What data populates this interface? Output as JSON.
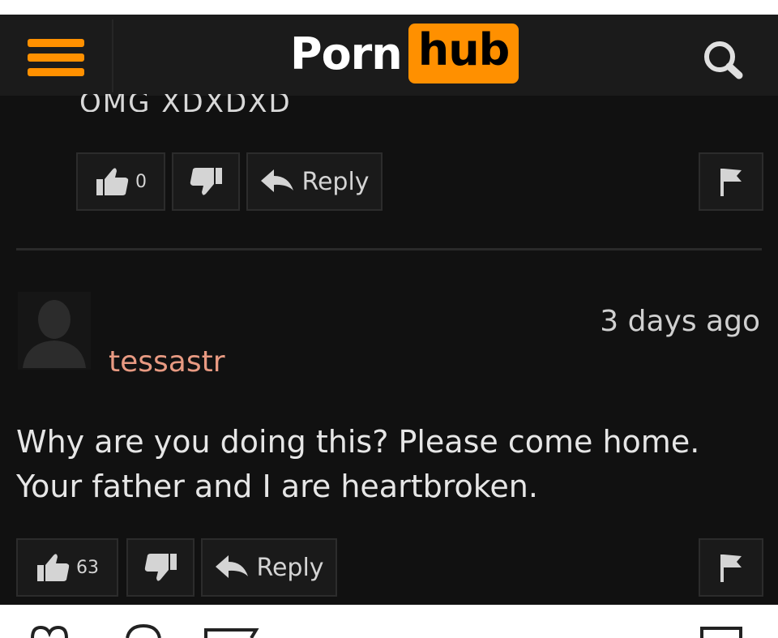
{
  "header": {
    "logo_part1": "Porn",
    "logo_part2": "hub",
    "menu_icon": "hamburger-menu-icon",
    "search_icon": "search-icon"
  },
  "colors": {
    "accent": "#ff9000",
    "background": "#111111",
    "username": "#e89a82"
  },
  "previous_comment": {
    "text_partial": "OMG XDXDXD",
    "like_count": "0",
    "reply_label": "Reply"
  },
  "comment": {
    "username": "tessastr",
    "timestamp": "3 days ago",
    "text": "Why are you doing this? Please come home. Your father and I are heartbroken.",
    "like_count": "63",
    "reply_label": "Reply"
  }
}
